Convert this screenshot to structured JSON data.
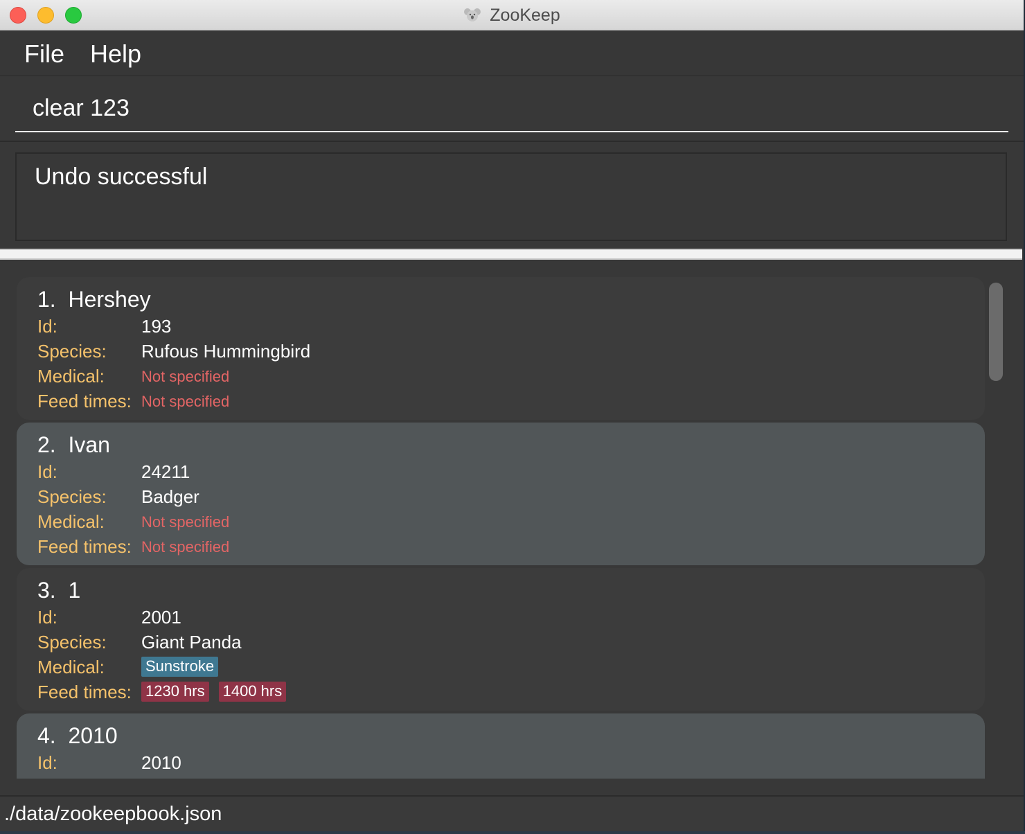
{
  "window": {
    "title": "ZooKeep",
    "app_icon": "koala-icon"
  },
  "menu": {
    "file": "File",
    "help": "Help"
  },
  "command": {
    "value": "clear 123"
  },
  "result": {
    "message": "Undo successful"
  },
  "labels": {
    "id": "Id:",
    "species": "Species:",
    "medical": "Medical:",
    "feed_times": "Feed times:"
  },
  "animals": [
    {
      "title": "1.  Hershey",
      "id": "193",
      "species": "Rufous Hummingbird",
      "medical": "Not specified",
      "feed_times": "Not specified"
    },
    {
      "title": "2.  Ivan",
      "id": "24211",
      "species": "Badger",
      "medical": "Not specified",
      "feed_times": "Not specified"
    },
    {
      "title": "3.  1",
      "id": "2001",
      "species": "Giant Panda",
      "medical_tags": [
        "Sunstroke"
      ],
      "feed_tags": [
        "1230 hrs",
        "1400 hrs"
      ]
    },
    {
      "title": "4.  2010",
      "id": "2010"
    }
  ],
  "status": {
    "path": "./data/zookeepbook.json"
  },
  "colors": {
    "label": "#f5c26b",
    "missing": "#e36565",
    "medical_tag": "#3f7891",
    "feed_tag": "#8f3447",
    "card_odd": "#3c3c3c",
    "card_even": "#515658"
  }
}
